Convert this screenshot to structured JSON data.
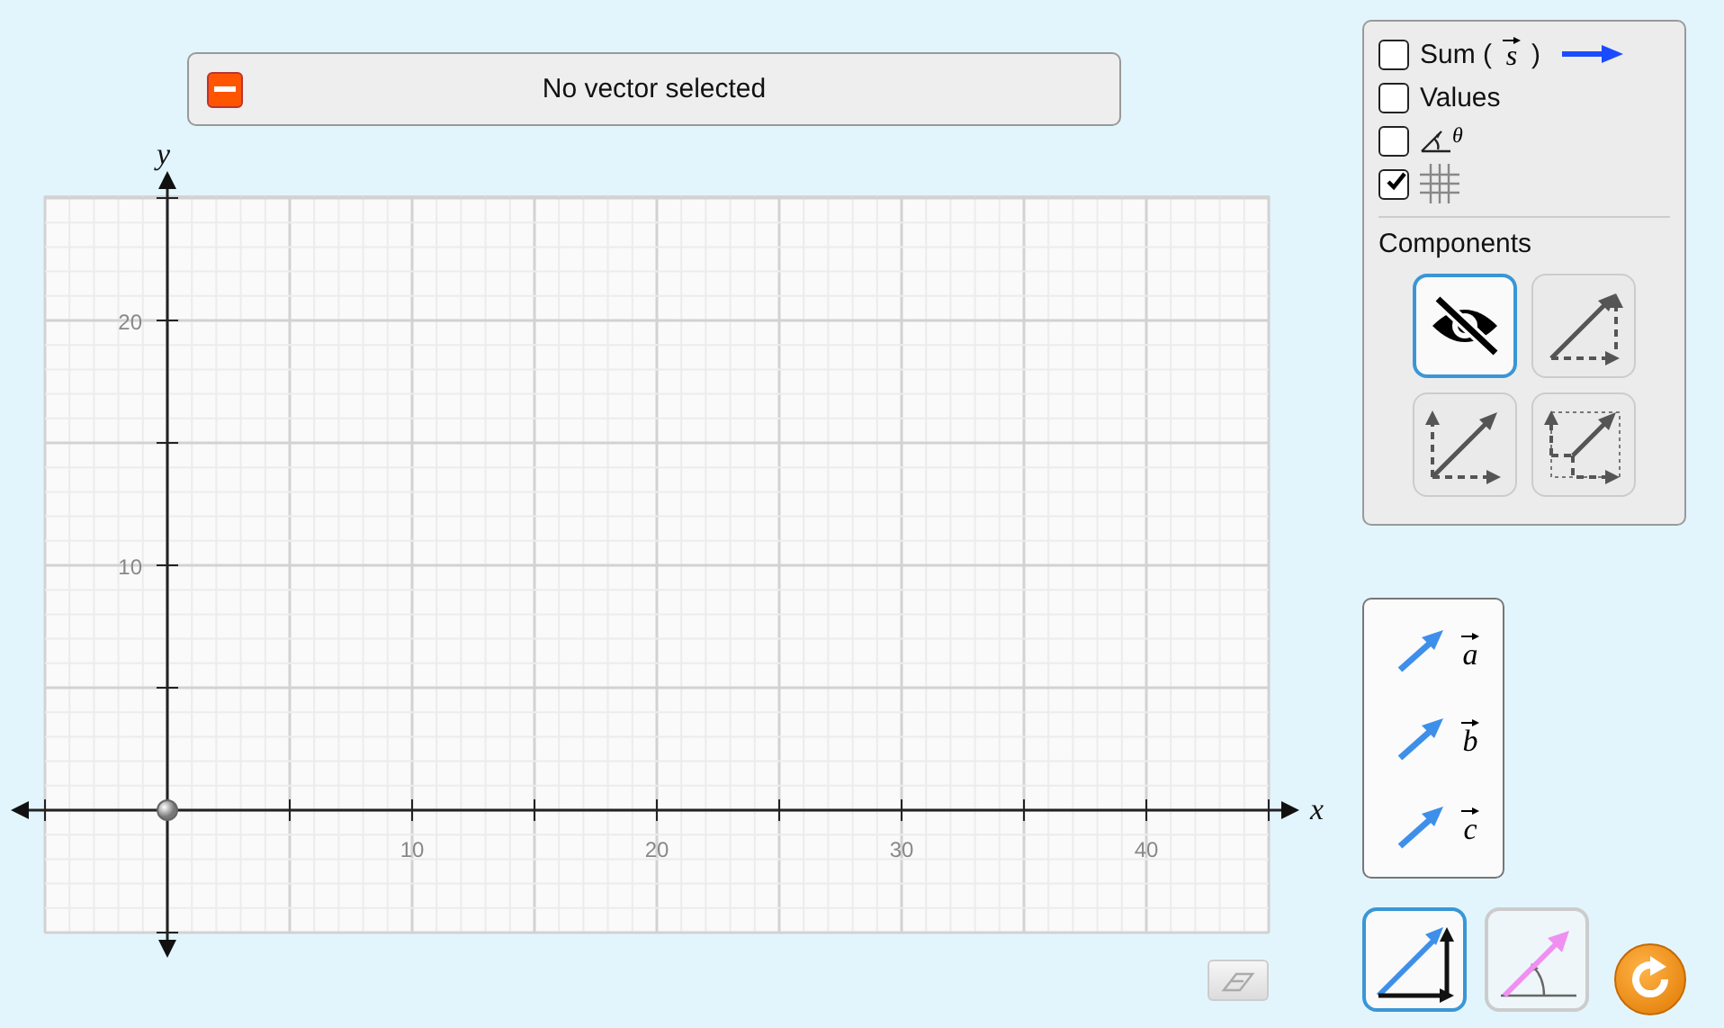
{
  "status": {
    "text": "No vector selected"
  },
  "graph": {
    "x_axis_label": "x",
    "y_axis_label": "y",
    "x_tick_labels": [
      "10",
      "20",
      "30",
      "40"
    ],
    "y_tick_labels": [
      "20",
      "10"
    ]
  },
  "options": [
    {
      "kind": "sum",
      "label": "Sum (",
      "symbol": "s",
      "label_end": ")",
      "checked": false
    },
    {
      "kind": "text",
      "label": "Values",
      "checked": false
    },
    {
      "kind": "angle",
      "symbol": "θ",
      "checked": false
    },
    {
      "kind": "grid",
      "checked": true
    }
  ],
  "components": {
    "title": "Components",
    "modes": [
      {
        "kind": "hidden",
        "selected": true
      },
      {
        "kind": "triangle",
        "selected": false
      },
      {
        "kind": "axes",
        "selected": false
      },
      {
        "kind": "projection",
        "selected": false
      }
    ]
  },
  "vectors": [
    {
      "symbol": "a"
    },
    {
      "symbol": "b"
    },
    {
      "symbol": "c"
    }
  ],
  "coordinate_modes": [
    {
      "kind": "cartesian",
      "selected": true
    },
    {
      "kind": "polar",
      "selected": false
    }
  ]
}
